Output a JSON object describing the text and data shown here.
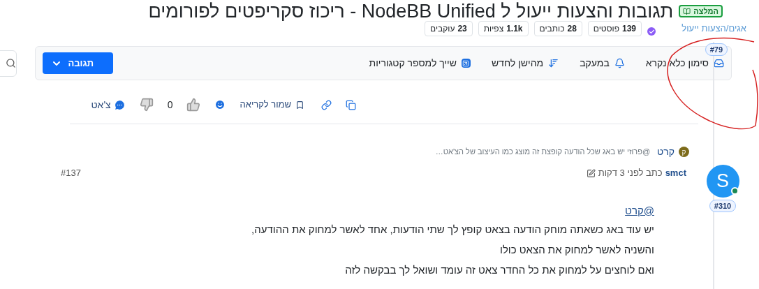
{
  "topic": {
    "title": "תגובות והצעות ייעול ל NodeBB Unified - ריכוז סקריפטים לפורומים",
    "badge": "המלצה"
  },
  "breadcrumb": "אגים/הצעות ייעול",
  "stats": [
    {
      "value": "139",
      "label": "פוסטים"
    },
    {
      "value": "28",
      "label": "כותבים"
    },
    {
      "value": "1.1k",
      "label": "צפיות"
    },
    {
      "value": "23",
      "label": "עוקבים"
    }
  ],
  "timeline_index": "#79",
  "toolbar": {
    "items": [
      {
        "kind": "inbox",
        "label": "סימון כלא נקרא"
      },
      {
        "kind": "bell",
        "label": "במעקב"
      },
      {
        "kind": "sort",
        "label": "מהישן לחדש"
      },
      {
        "kind": "move",
        "label": "שייך למספר קטגוריות"
      }
    ],
    "reply_button": "תגובה"
  },
  "post_actions": {
    "save": "שמור לקריאה",
    "votes": "0",
    "chat": "צ'אט"
  },
  "reply_preview": {
    "avatar_letter": "ק",
    "author": "קרט",
    "text": "@פרוזי יש באג שכל הודעה קופצת זה מוצג כמו העיצוב של הצ'אט…"
  },
  "post": {
    "index": "#310",
    "avatar_letter": "S",
    "online": true,
    "author": "smct",
    "time": "כתב לפני 3 דקות",
    "number": "#137",
    "mention": "@קרט",
    "lines": [
      "יש עוד באג כשאתה מוחק הודעה בצאט קופץ לך שתי הודעות, אחד לאשר למחוק את ההודעה,",
      "והשניה לאשר למחוק את הצאט כולו",
      "ואם לוחצים על למחוק את כל החדר צאט זה עומד ושואל לך בבקשה לזה"
    ]
  }
}
